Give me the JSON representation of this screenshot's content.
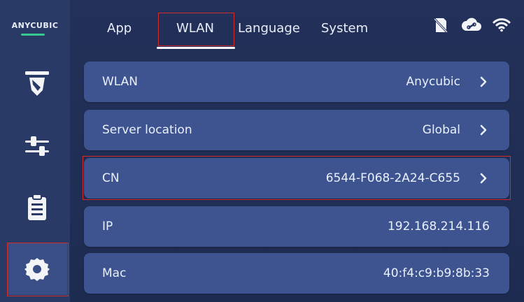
{
  "brand": {
    "logo_text": "ANYCUBIC",
    "accent": "#36c88c"
  },
  "sidebar": {
    "items": [
      {
        "name": "print-icon",
        "active": false
      },
      {
        "name": "controls-icon",
        "active": false
      },
      {
        "name": "files-icon",
        "active": false
      },
      {
        "name": "settings-gear-icon",
        "active": true
      }
    ]
  },
  "tabs": [
    {
      "label": "App",
      "active": false
    },
    {
      "label": "WLAN",
      "active": true
    },
    {
      "label": "Language",
      "active": false
    },
    {
      "label": "System",
      "active": false
    }
  ],
  "status_icons": [
    "no-sd-card-icon",
    "cloud-link-icon",
    "wifi-icon"
  ],
  "rows": [
    {
      "label": "WLAN",
      "value": "Anycubic",
      "has_chevron": true
    },
    {
      "label": "Server location",
      "value": "Global",
      "has_chevron": true
    },
    {
      "label": "CN",
      "value": "6544-F068-2A24-C655",
      "has_chevron": true
    },
    {
      "label": "IP",
      "value": "192.168.214.116",
      "has_chevron": false
    },
    {
      "label": "Mac",
      "value": "40:f4:c9:b9:8b:33",
      "has_chevron": false
    }
  ],
  "colors": {
    "background": "#1f2d52",
    "row": "#3d5490",
    "sidebar": "#2a3a66",
    "highlight": "#d42a2a"
  }
}
